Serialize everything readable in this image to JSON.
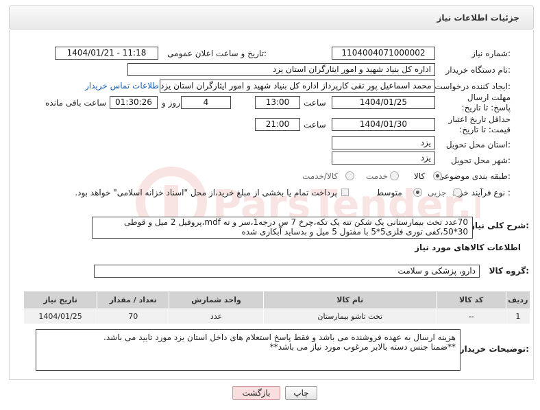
{
  "header": {
    "title": "جزئیات اطلاعات نیاز"
  },
  "form": {
    "need_number": {
      "label": "شماره نیاز:",
      "value": "1104004071000002"
    },
    "announce": {
      "label": "تاریخ و ساعت اعلان عمومی:",
      "value": "1404/01/21 - 11:18"
    },
    "buyer_org": {
      "label": "نام دستگاه خریدار:",
      "value": "اداره کل بنیاد شهید و امور ایثارگران استان یزد"
    },
    "requester": {
      "label": "ایجاد کننده درخواست:",
      "value": "محمد اسماعیل پور تقی کارپرداز اداره کل بنیاد شهید و امور ایثارگران استان یزد",
      "contact_link": "اطلاعات تماس خریدار"
    },
    "reply_deadline": {
      "label": "مهلت ارسال پاسخ: تا تاریخ:",
      "date": "1404/01/25",
      "time_label": "ساعت",
      "time": "13:00",
      "days": "4",
      "days_label": "روز و",
      "remaining": "01:30:26",
      "remaining_label": "ساعت باقی مانده"
    },
    "price_validity": {
      "label": "حداقل تاریخ اعتبار قیمت: تا تاریخ:",
      "date": "1404/01/30",
      "time_label": "ساعت",
      "time": "21:00"
    },
    "province": {
      "label": "استان محل تحویل:",
      "value": "یزد"
    },
    "city": {
      "label": "شهر محل تحویل:",
      "value": "یزد"
    },
    "category": {
      "label": "طبقه بندی موضوعی:",
      "options": [
        "کالا",
        "خدمت",
        "کالا/خدمت"
      ],
      "selected": "کالا"
    },
    "process": {
      "label": "نوع فرآیند خرید :",
      "options": [
        "جزیی",
        "متوسط"
      ],
      "selected": "متوسط",
      "payment_note": "پرداخت تمام یا بخشی از مبلغ خرید،از محل \"اسناد خزانه اسلامی\" خواهد بود."
    },
    "description": {
      "label": "شرح کلی نیاز:",
      "line1": "70عدد تخت بیمارستانی یک شکن تنه یک تکه،چرخ 7 س درجه1،سر و ته mdf،پروفیل 2 میل و قوطی",
      "line2": "30*50،کفی توری فلزی5*5 با مفتول 5 میل و بدساید آبکاری شده"
    },
    "goods_section_title": "اطلاعات کالاهای مورد نیاز",
    "goods_group": {
      "label": "گروه کالا:",
      "value": "دارو، پزشکی و سلامت"
    },
    "buyer_notes": {
      "label": "توضیحات خریدار:",
      "line1": "هزینه ارسال به عهده فروشنده می باشد و فقط پاسخ استعلام های داخل استان یزد مورد تایید می باشد.",
      "line2": "**ضمنا جنس دسته بالابر مرغوب مورد نیاز می باشد**"
    }
  },
  "table": {
    "headers": [
      "ردیف",
      "کد کالا",
      "نام کالا",
      "واحد شمارش",
      "تعداد / مقدار",
      "تاریخ نیاز"
    ],
    "rows": [
      [
        "1",
        "--",
        "تخت تاشو بیمارستان",
        "عدد",
        "70",
        "1404/01/25"
      ]
    ]
  },
  "buttons": {
    "print": "چاپ",
    "back": "بازگشت"
  },
  "watermark_text": "ParsTender.net"
}
